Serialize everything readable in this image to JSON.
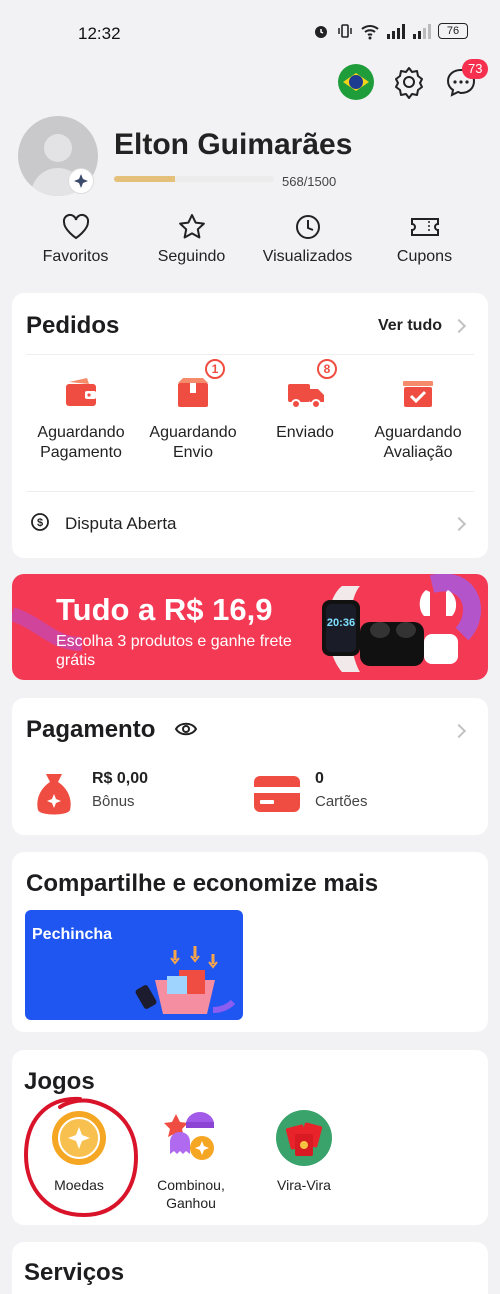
{
  "status_bar": {
    "time": "12:32",
    "battery": "76"
  },
  "header": {
    "notification_count": "73"
  },
  "profile": {
    "name": "Elton Guimarães",
    "progress_text": "568/1500",
    "progress_fraction": 0.3787
  },
  "quick_links": [
    {
      "label": "Favoritos",
      "icon": "heart-icon"
    },
    {
      "label": "Seguindo",
      "icon": "star-icon"
    },
    {
      "label": "Visualizados",
      "icon": "clock-icon"
    },
    {
      "label": "Cupons",
      "icon": "ticket-icon"
    }
  ],
  "orders": {
    "title": "Pedidos",
    "see_all": "Ver tudo",
    "items": [
      {
        "label": "Aguardando Pagamento",
        "icon": "wallet-icon",
        "badge": ""
      },
      {
        "label": "Aguardando Envio",
        "icon": "package-icon",
        "badge": "1"
      },
      {
        "label": "Enviado",
        "icon": "truck-icon",
        "badge": "8"
      },
      {
        "label": "Aguardando Avaliação",
        "icon": "review-box-icon",
        "badge": ""
      }
    ],
    "dispute": "Disputa Aberta"
  },
  "promo_banner": {
    "title": "Tudo a R$ 16,9",
    "subtitle": "Escolha 3 produtos e ganhe frete grátis",
    "watch_time": "20:36"
  },
  "payment": {
    "title": "Pagamento",
    "bonus_value": "R$ 0,00",
    "bonus_label": "Bônus",
    "cards_value": "0",
    "cards_label": "Cartões"
  },
  "share": {
    "title": "Compartilhe e economize mais",
    "tile_label": "Pechincha"
  },
  "games": {
    "title": "Jogos",
    "items": [
      {
        "label": "Moedas"
      },
      {
        "label": "Combinou, Ganhou"
      },
      {
        "label": "Vira-Vira"
      }
    ]
  },
  "services": {
    "title": "Serviços"
  },
  "colors": {
    "accent": "#f04d42",
    "banner": "#f43954",
    "badge": "#f52f4d",
    "annotation": "#d9142a",
    "share_tile": "#1f56f2"
  }
}
